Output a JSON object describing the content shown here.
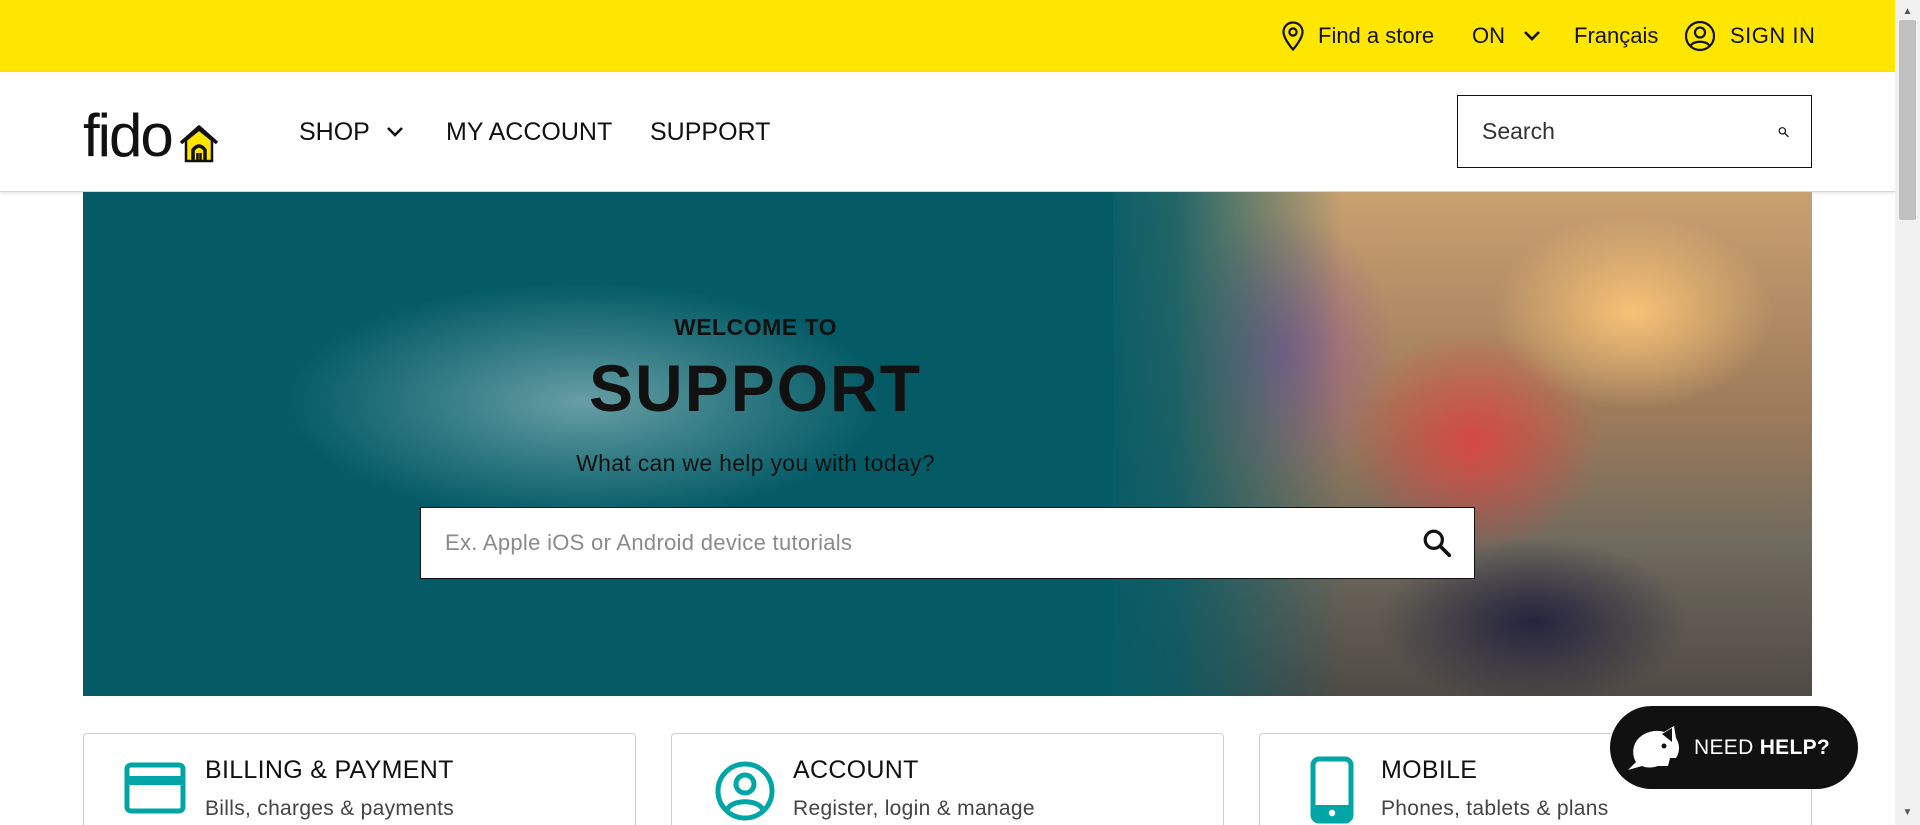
{
  "utility_bar": {
    "find_store": "Find a store",
    "province": "ON",
    "language": "Français",
    "sign_in": "SIGN IN"
  },
  "nav": {
    "logo_text": "fido",
    "shop": "SHOP",
    "my_account": "MY ACCOUNT",
    "support": "SUPPORT",
    "search_placeholder": "Search"
  },
  "hero": {
    "eyebrow": "WELCOME TO",
    "title": "SUPPORT",
    "subtitle": "What can we help you with today?",
    "search_placeholder": "Ex. Apple iOS or Android device tutorials"
  },
  "cards": [
    {
      "title": "BILLING & PAYMENT",
      "subtitle": "Bills, charges & payments",
      "icon": "credit-card-icon"
    },
    {
      "title": "ACCOUNT",
      "subtitle": "Register, login & manage",
      "icon": "user-circle-icon"
    },
    {
      "title": "MOBILE",
      "subtitle": "Phones, tablets & plans",
      "icon": "smartphone-icon"
    }
  ],
  "need_help": {
    "prefix": "NEED",
    "emphasis": "HELP?"
  },
  "colors": {
    "brand_yellow": "#ffe600",
    "hero_teal": "#045b66",
    "icon_teal": "#00a6a6",
    "text_dark": "#111111"
  }
}
